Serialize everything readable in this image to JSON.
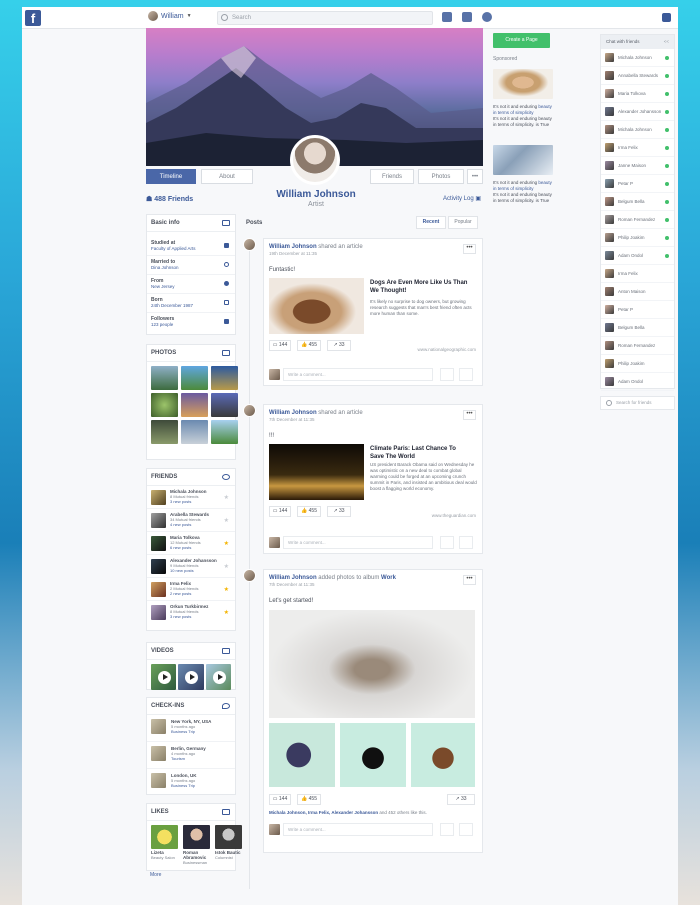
{
  "topbar": {
    "user": "William",
    "search_placeholder": "Search"
  },
  "profile": {
    "name": "William Johnson",
    "role": "Artist",
    "friends_count": "488 Friends",
    "activity_log": "Activity Log"
  },
  "tabs": {
    "timeline": "Timeline",
    "about": "About",
    "friends": "Friends",
    "photos": "Photos",
    "more": "•••"
  },
  "basic_info": {
    "title": "Basic info",
    "items": [
      {
        "label": "Studied at",
        "value": "Faculty of Applied Arts"
      },
      {
        "label": "Married to",
        "value": "Dina Johnson"
      },
      {
        "label": "From",
        "value": "New Jersey"
      },
      {
        "label": "Born",
        "value": "24th December 1987"
      },
      {
        "label": "Followers",
        "value": "123 people"
      }
    ]
  },
  "photos": {
    "title": "PHOTOS"
  },
  "friends": {
    "title": "FRIENDS",
    "items": [
      {
        "name": "Michala Johnson",
        "mutual": "8 Mutual friends",
        "posts": "3 new posts"
      },
      {
        "name": "Arabella Stewards",
        "mutual": "34 Mutual friends",
        "posts": "4 new posts"
      },
      {
        "name": "Maria Tolkova",
        "mutual": "12 Mutual friends",
        "posts": "6 new posts"
      },
      {
        "name": "Alexander Johansson",
        "mutual": "9 Mutual friends",
        "posts": "10 new posts"
      },
      {
        "name": "Irma Felix",
        "mutual": "2 Mutual friends",
        "posts": "2 new posts"
      },
      {
        "name": "Orkun Turkbirmez",
        "mutual": "8 Mutual friends",
        "posts": "3 new posts"
      }
    ]
  },
  "videos": {
    "title": "VIDEOS"
  },
  "checkins": {
    "title": "CHECK-INS",
    "items": [
      {
        "place": "New York, NY, USA",
        "when": "5 months ago",
        "tag": "Business Trip"
      },
      {
        "place": "Berlin, Germany",
        "when": "4 months ago",
        "tag": "Tourism"
      },
      {
        "place": "London, UK",
        "when": "5 months ago",
        "tag": "Business Trip"
      }
    ]
  },
  "likes": {
    "title": "LIKES",
    "items": [
      {
        "name": "Lizeta",
        "sub": "Beauty Salon"
      },
      {
        "name": "Roman Abramovic",
        "sub": "Businessman"
      },
      {
        "name": "Istok Bautic",
        "sub": "Columnist"
      }
    ],
    "more": "More"
  },
  "posts_header": {
    "title": "Posts",
    "recent": "Recent",
    "popular": "Popular"
  },
  "post1": {
    "author": "William Johnson",
    "action": "shared an article",
    "date": "19th December at 11:35",
    "text": "Funtastic!",
    "article_title": "Dogs Are Even More Like Us Than We Thought!",
    "article_desc": "It's likely no surprise to dog owners, but growing research suggests that man's best friend often acts more human than some.",
    "source": "www.nationalgeographic.com",
    "comments": "144",
    "likes": "455",
    "shares": "33",
    "comment_placeholder": "Write a comment..."
  },
  "post2": {
    "author": "William Johnson",
    "action": "shared an article",
    "date": "7th December at 11:35",
    "text": "!!!",
    "article_title": "Climate Paris: Last Chance To Save The World",
    "article_desc": "US president Barack Obama said on Wednesday he was optimistic on a new deal to combat global warming could be forged at an upcoming crunch summit in Paris, and insisted an ambitious deal would boost a flagging world economy.",
    "source": "www.theguardian.com",
    "comments": "144",
    "likes": "455",
    "shares": "33",
    "comment_placeholder": "Write a comment..."
  },
  "post3": {
    "author": "William Johnson",
    "action": "added photos to album",
    "album": "Work",
    "date": "7th December at 11:35",
    "text": "Let's get started!",
    "comments": "144",
    "likes": "455",
    "shares": "33",
    "liked_by_names": "Michala Johnson, Irma Felix, Alexander Johansson",
    "liked_by_rest": "and 452 others like this.",
    "comment_placeholder": "Write a comment..."
  },
  "right": {
    "create_page": "Create a Page",
    "sponsored": "Sponsored",
    "ads": [
      {
        "line1": "It's not it and enduring",
        "highlight": "beauty in terms of simplicity",
        "line2": "It's not it and enduring beauty in terms of simplicity. is True"
      },
      {
        "line1": "It's not it and enduring",
        "highlight": "beauty in terms of simplicity",
        "line2": "It's not it and enduring beauty in terms of simplicity. is True"
      }
    ]
  },
  "chat": {
    "title": "Chat with friends",
    "collapse": "<<",
    "items": [
      "Michala Johnson",
      "Annabella Stewards",
      "Maria Tolkova",
      "Alexander Johansson",
      "Michala Johnson",
      "Irma Felix",
      "Janne Maison",
      "Petar P",
      "Belgum Bella",
      "Roman Fernandez",
      "Philip Joakim",
      "Adam Ondol",
      "Irma Felix",
      "Anton Maison",
      "Petar P",
      "Belgum Bella",
      "Roman Fernandez",
      "Philip Joakim",
      "Adam Ondol"
    ],
    "search_placeholder": "Search for friends"
  },
  "colors": {
    "brand": "#3b5998",
    "green": "#42c06b",
    "star": "#f4b400"
  }
}
